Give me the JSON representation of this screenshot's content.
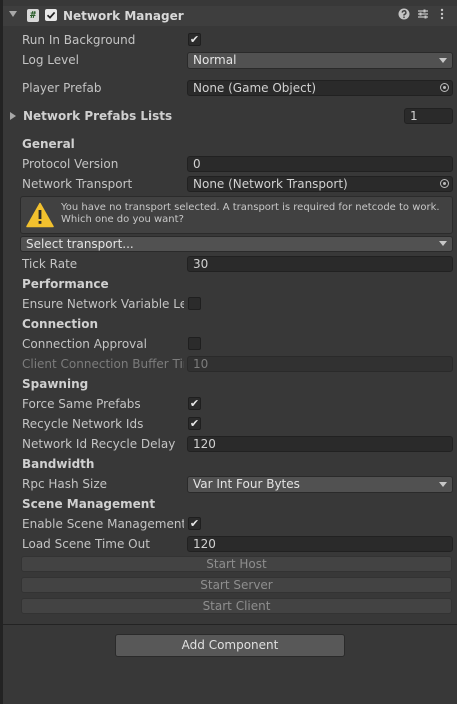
{
  "component": {
    "title": "Network Manager",
    "script_glyph": "#"
  },
  "fields": {
    "run_in_background": {
      "label": "Run In Background",
      "checked": true
    },
    "log_level": {
      "label": "Log Level",
      "value": "Normal"
    },
    "player_prefab": {
      "label": "Player Prefab",
      "value": "None (Game Object)"
    },
    "network_prefabs_lists": {
      "label": "Network Prefabs Lists",
      "count": "1"
    }
  },
  "sections": {
    "general": "General",
    "performance": "Performance",
    "connection": "Connection",
    "spawning": "Spawning",
    "bandwidth": "Bandwidth",
    "scene_management": "Scene Management"
  },
  "general": {
    "protocol_version": {
      "label": "Protocol Version",
      "value": "0"
    },
    "network_transport": {
      "label": "Network Transport",
      "value": "None (Network Transport)"
    },
    "warning": "You have no transport selected. A transport is required for netcode to work. Which one do you want?",
    "select_transport": "Select transport...",
    "tick_rate": {
      "label": "Tick Rate",
      "value": "30"
    }
  },
  "performance": {
    "ensure_len": {
      "label": "Ensure Network Variable Length Safety",
      "checked": false
    }
  },
  "connection": {
    "connection_approval": {
      "label": "Connection Approval",
      "checked": false
    },
    "client_buffer": {
      "label": "Client Connection Buffer Timeout",
      "value": "10"
    }
  },
  "spawning": {
    "force_same_prefabs": {
      "label": "Force Same Prefabs",
      "checked": true
    },
    "recycle_ids": {
      "label": "Recycle Network Ids",
      "checked": true
    },
    "recycle_delay": {
      "label": "Network Id Recycle Delay",
      "value": "120"
    }
  },
  "bandwidth": {
    "rpc_hash_size": {
      "label": "Rpc Hash Size",
      "value": "Var Int Four Bytes"
    }
  },
  "scene": {
    "enable_scene_management": {
      "label": "Enable Scene Management",
      "checked": true
    },
    "load_timeout": {
      "label": "Load Scene Time Out",
      "value": "120"
    }
  },
  "buttons": {
    "start_host": "Start Host",
    "start_server": "Start Server",
    "start_client": "Start Client",
    "add_component": "Add Component"
  },
  "check_glyph": "✔",
  "colors": {
    "background": "#383838",
    "field": "#2a2a2a",
    "warning": "#f2c12e"
  }
}
